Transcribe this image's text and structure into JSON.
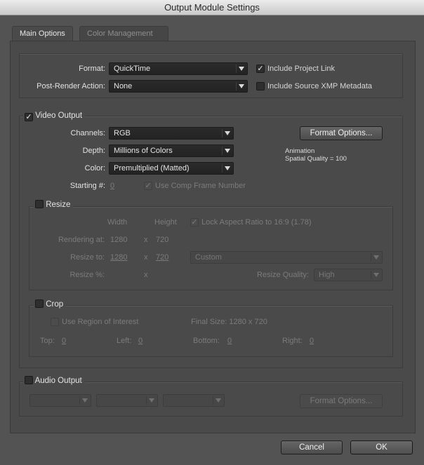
{
  "window": {
    "title": "Output Module Settings"
  },
  "tabs": [
    {
      "label": "Main Options"
    },
    {
      "label": "Color Management"
    }
  ],
  "format_section": {
    "format_label": "Format:",
    "format_value": "QuickTime",
    "post_render_label": "Post-Render Action:",
    "post_render_value": "None",
    "include_project_link": {
      "label": "Include Project Link",
      "checked": true
    },
    "include_xmp": {
      "label": "Include Source XMP Metadata",
      "checked": false
    }
  },
  "video_output": {
    "title": "Video Output",
    "checked": true,
    "channels_label": "Channels:",
    "channels_value": "RGB",
    "depth_label": "Depth:",
    "depth_value": "Millions of Colors",
    "color_label": "Color:",
    "color_value": "Premultiplied (Matted)",
    "format_options_button": "Format Options...",
    "codec_info_line1": "Animation",
    "codec_info_line2": "Spatial Quality = 100",
    "starting_label": "Starting #:",
    "starting_value": "0",
    "use_comp_frame": {
      "label": "Use Comp Frame Number",
      "checked": true
    }
  },
  "resize": {
    "title": "Resize",
    "checked": false,
    "width_header": "Width",
    "height_header": "Height",
    "lock_aspect": {
      "label": "Lock Aspect Ratio to 16:9 (1.78)",
      "checked": true
    },
    "rendering_label": "Rendering at:",
    "rendering_w": "1280",
    "rendering_x": "x",
    "rendering_h": "720",
    "resize_to_label": "Resize to:",
    "resize_to_w": "1280",
    "resize_to_x": "x",
    "resize_to_h": "720",
    "preset_value": "Custom",
    "percent_label": "Resize %:",
    "percent_x": "x",
    "quality_label": "Resize Quality:",
    "quality_value": "High"
  },
  "crop": {
    "title": "Crop",
    "checked": false,
    "region": {
      "label": "Use Region of Interest",
      "checked": false
    },
    "final_size": "Final Size: 1280 x 720",
    "top_label": "Top:",
    "top_value": "0",
    "left_label": "Left:",
    "left_value": "0",
    "bottom_label": "Bottom:",
    "bottom_value": "0",
    "right_label": "Right:",
    "right_value": "0"
  },
  "audio_output": {
    "title": "Audio Output",
    "checked": false,
    "format_options_button": "Format Options..."
  },
  "footer": {
    "cancel_label": "Cancel",
    "ok_label": "OK"
  },
  "colors": {
    "dialog_bg": "#535353",
    "panel_bg": "#4a4a4a",
    "select_bg": "#232323",
    "disabled_text": "#7b7b7b"
  }
}
